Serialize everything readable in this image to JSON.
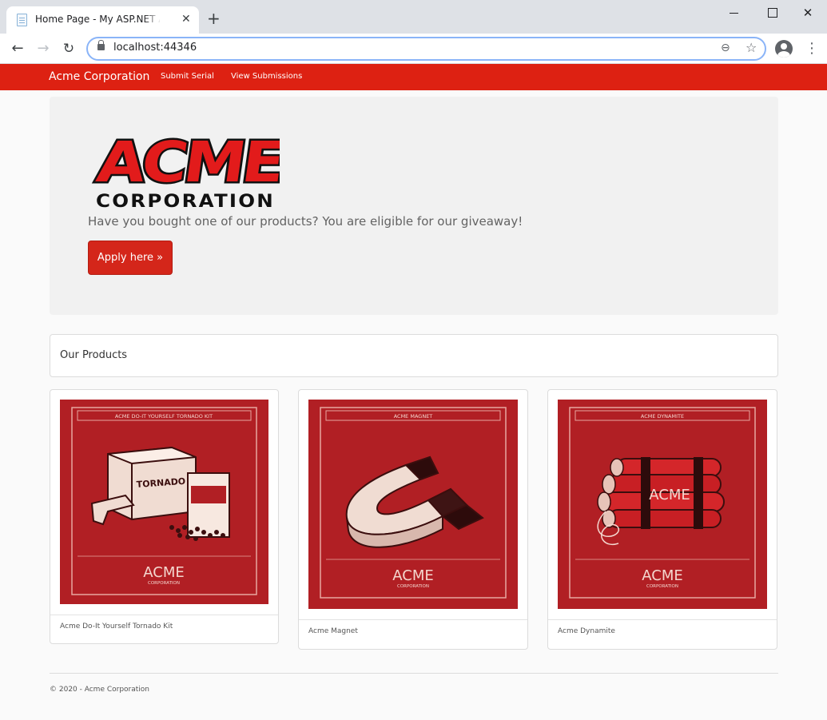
{
  "browser": {
    "tab_title": "Home Page - My ASP.NET Application",
    "url": "localhost:44346"
  },
  "navbar": {
    "brand": "Acme Corporation",
    "links": [
      "Submit Serial",
      "View Submissions"
    ],
    "color": "#dd2112"
  },
  "hero": {
    "logo_text": "ACME",
    "logo_subtext": "CORPORATION",
    "lead": "Have you bought one of our products? You are eligible for our giveaway!",
    "button_label": "Apply here »"
  },
  "products": {
    "heading": "Our Products",
    "items": [
      {
        "poster_title": "ACME DO-IT YOURSELF TORNADO KIT",
        "poster_label": "TORNADO KIT",
        "poster_brand": "ACME",
        "poster_brand_sub": "CORPORATION",
        "name": "Acme Do-It Yourself Tornado Kit"
      },
      {
        "poster_title": "ACME MAGNET",
        "poster_brand": "ACME",
        "poster_brand_sub": "CORPORATION",
        "name": "Acme Magnet"
      },
      {
        "poster_title": "ACME DYNAMITE",
        "poster_label": "ACME",
        "poster_brand": "ACME",
        "poster_brand_sub": "CORPORATION",
        "name": "Acme Dynamite"
      }
    ]
  },
  "footer": {
    "text": "© 2020 - Acme Corporation"
  }
}
